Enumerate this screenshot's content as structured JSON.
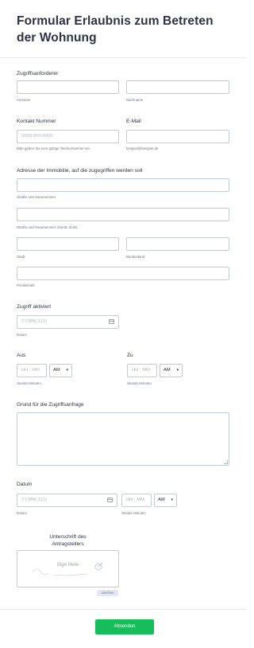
{
  "title": "Formular Erlaubnis zum Betreten der Wohnung",
  "requester": {
    "label": "Zugriffsanforderer",
    "first_sub": "Vorname",
    "last_sub": "Nachname"
  },
  "contact": {
    "label": "Kontakt Nummer",
    "placeholder": "(000) 000-0000",
    "sub": "Bitte geben Sie eine gültige Telefonnummer ein."
  },
  "email": {
    "label": "E-Mail",
    "sub": "beispiel@beispiel.de"
  },
  "address": {
    "label": "Adresse der Immobilie, auf die zugegriffen werden soll",
    "street_sub": "Straße und Hausnummer",
    "street2_sub": "Straße und Hausnummer (zweite Zeile)",
    "city_sub": "Stadt",
    "state_sub": "Bundesland",
    "zip_sub": "Postleitzahl"
  },
  "access": {
    "label": "Zugriff aktiviert",
    "placeholder": "TT-MM-JJJJ",
    "sub": "Datum"
  },
  "from": {
    "label": "Aus",
    "placeholder": "HH : MM",
    "ampm": "AM",
    "sub": "Stunde Minuten"
  },
  "to": {
    "label": "Zu",
    "placeholder": "HH : MM",
    "ampm": "AM",
    "sub": "Stunde Minuten"
  },
  "reason": {
    "label": "Grund für die Zugriffsanfrage"
  },
  "date": {
    "label": "Datum",
    "placeholder": "TT-MM-JJJJ",
    "date_sub": "Datum",
    "time_placeholder": "HH : MM",
    "ampm": "AM",
    "time_sub": "Stunde Minuten"
  },
  "signature": {
    "label_line1": "Unterschrift des",
    "label_line2": "Antragstellers",
    "hint": "Sign Here",
    "clear": "Löschen"
  },
  "submit": "Absenden",
  "icons": {
    "calendar": "calendar-icon",
    "chevron": "chevron-down-icon",
    "pen": "pen-icon"
  },
  "colors": {
    "submit": "#18bd5b",
    "border": "#c3cad8",
    "text": "#2c3345"
  }
}
